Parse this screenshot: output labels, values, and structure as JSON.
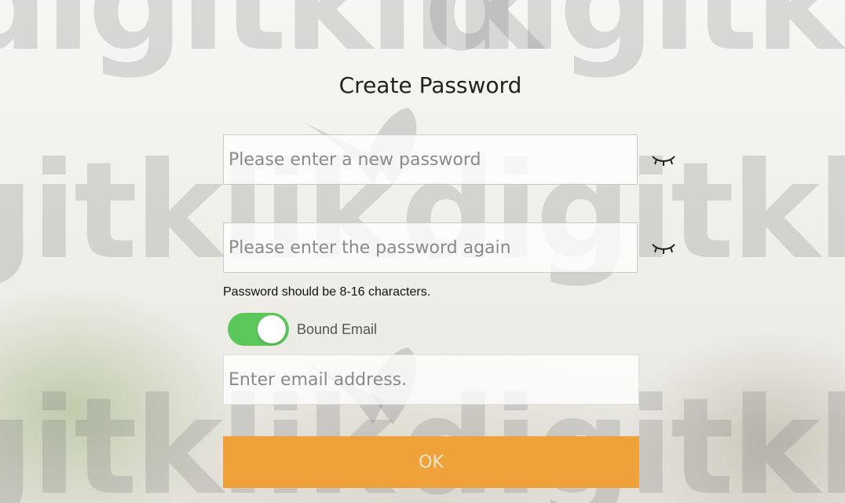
{
  "dialog": {
    "title": "Create Password",
    "new_password": {
      "placeholder": "Please enter a new password",
      "value": ""
    },
    "confirm_password": {
      "placeholder": "Please enter the password again",
      "value": ""
    },
    "hint": "Password should be 8-16 characters.",
    "bound_email": {
      "label": "Bound Email",
      "enabled": true
    },
    "email": {
      "placeholder": "Enter email address.",
      "value": ""
    },
    "ok_label": "OK"
  },
  "watermark": {
    "text": "digitklik"
  },
  "colors": {
    "toggle_on": "#5cc85c",
    "ok_button": "#f0a23a",
    "ok_text": "#fbe7c9"
  },
  "icons": {
    "password_visibility": "eye-closed-icon"
  }
}
